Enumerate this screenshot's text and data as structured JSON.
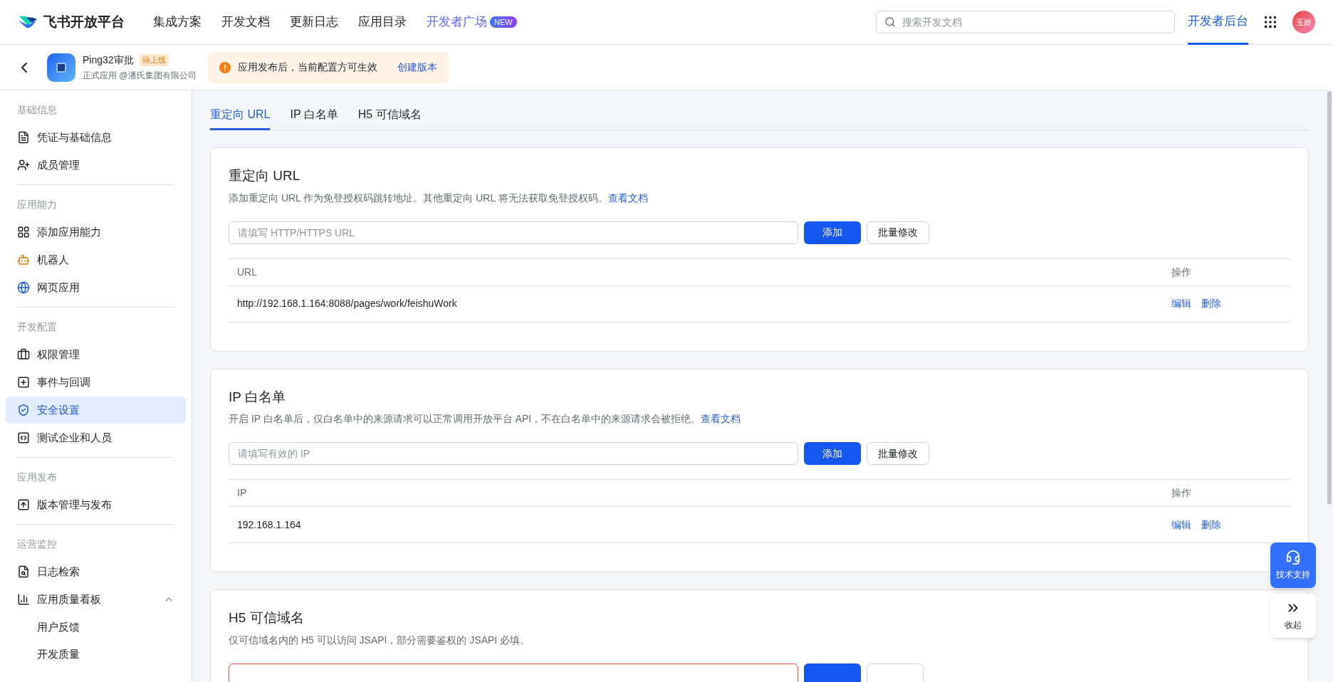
{
  "brand": {
    "name": "飞书开放平台"
  },
  "top_nav": [
    {
      "label": "集成方案",
      "kind": "plain"
    },
    {
      "label": "开发文档",
      "kind": "plain"
    },
    {
      "label": "更新日志",
      "kind": "plain"
    },
    {
      "label": "应用目录",
      "kind": "plain"
    },
    {
      "label": "开发者广场",
      "kind": "featured",
      "badge": "NEW"
    }
  ],
  "search": {
    "placeholder": "搜索开发文档"
  },
  "console_link": {
    "label": "开发者后台",
    "selected": true
  },
  "user": {
    "avatar_text": "玉娇"
  },
  "app": {
    "name": "Ping32审批",
    "status": "待上线",
    "subtitle": "正式应用 @潘氏集团有限公司"
  },
  "notice": {
    "text": "应用发布后，当前配置方可生效",
    "link": "创建版本"
  },
  "sidebar": {
    "sections": [
      {
        "title": "基础信息",
        "items": [
          {
            "label": "凭证与基础信息",
            "selected": false
          },
          {
            "label": "成员管理",
            "selected": false
          }
        ]
      },
      {
        "title": "应用能力",
        "items": [
          {
            "label": "添加应用能力",
            "selected": false
          },
          {
            "label": "机器人",
            "selected": false
          },
          {
            "label": "网页应用",
            "selected": false
          }
        ]
      },
      {
        "title": "开发配置",
        "items": [
          {
            "label": "权限管理",
            "selected": false
          },
          {
            "label": "事件与回调",
            "selected": false
          },
          {
            "label": "安全设置",
            "selected": true
          },
          {
            "label": "测试企业和人员",
            "selected": false
          }
        ]
      },
      {
        "title": "应用发布",
        "items": [
          {
            "label": "版本管理与发布",
            "selected": false
          }
        ]
      },
      {
        "title": "运营监控",
        "items": [
          {
            "label": "日志检索",
            "selected": false
          },
          {
            "label": "应用质量看板",
            "selected": false,
            "expanded": true,
            "children": [
              {
                "label": "用户反馈",
                "selected": false
              },
              {
                "label": "开发质量",
                "selected": false
              }
            ]
          }
        ]
      }
    ]
  },
  "tabs": [
    {
      "label": "重定向 URL",
      "selected": true
    },
    {
      "label": "IP 白名单",
      "selected": false
    },
    {
      "label": "H5 可信域名",
      "selected": false
    }
  ],
  "cards": [
    {
      "title": "重定向 URL",
      "description": "添加重定向 URL 作为免登授权码跳转地址。其他重定向 URL 将无法获取免登授权码。",
      "doc_link": "查看文档",
      "input": {
        "placeholder": "请填写 HTTP/HTTPS URL",
        "invalid": false
      },
      "buttons": [
        {
          "kind": "primary",
          "label": "添加"
        },
        {
          "kind": "default",
          "label": "批量修改"
        }
      ],
      "table": {
        "columns": [
          "URL",
          "操作"
        ],
        "rows": [
          {
            "cells": [
              "http://192.168.1.164:8088/pages/work/feishuWork"
            ],
            "actions": [
              "编辑",
              "删除"
            ]
          }
        ]
      }
    },
    {
      "title": "IP 白名单",
      "description": "开启 IP 白名单后，仅白名单中的来源请求可以正常调用开放平台 API，不在白名单中的来源请求会被拒绝。",
      "doc_link": "查看文档",
      "input": {
        "placeholder": "请填写有效的 IP",
        "invalid": false
      },
      "buttons": [
        {
          "kind": "primary",
          "label": "添加"
        },
        {
          "kind": "default",
          "label": "批量修改"
        }
      ],
      "table": {
        "columns": [
          "IP",
          "操作"
        ],
        "rows": [
          {
            "cells": [
              "192.168.1.164"
            ],
            "actions": [
              "编辑",
              "删除"
            ]
          }
        ]
      }
    },
    {
      "title": "H5 可信域名",
      "description": "仅可信域名内的 H5 可以访问 JSAPI，部分需要鉴权的 JSAPI 必填。",
      "input": {
        "invalid": true
      },
      "buttons": [
        {
          "kind": "primary"
        },
        {
          "kind": "default"
        }
      ]
    }
  ],
  "support": {
    "label": "技术支持"
  },
  "collapse": {
    "label": "收起"
  }
}
